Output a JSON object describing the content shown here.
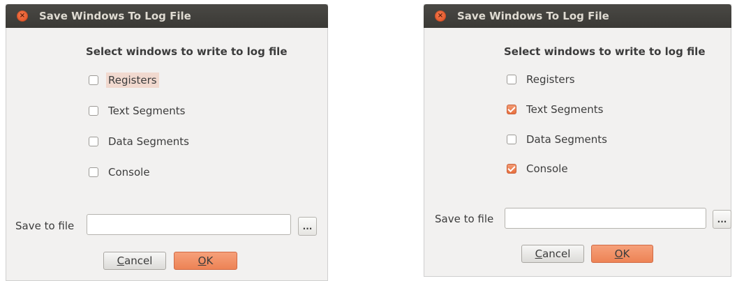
{
  "dialogs": [
    {
      "title": "Save Windows To Log File",
      "heading": "Select windows to write to log file",
      "options": [
        {
          "label": "Registers",
          "checked": false,
          "focused": true
        },
        {
          "label": "Text Segments",
          "checked": false
        },
        {
          "label": "Data Segments",
          "checked": false
        },
        {
          "label": "Console",
          "checked": false
        }
      ],
      "save_to_file_label": "Save to file",
      "file_value": "",
      "browse_label": "...",
      "cancel": {
        "mnemonic": "C",
        "rest": "ancel"
      },
      "ok": {
        "mnemonic": "O",
        "rest": "K"
      }
    },
    {
      "title": "Save Windows To Log File",
      "heading": "Select windows to write to log file",
      "options": [
        {
          "label": "Registers",
          "checked": false
        },
        {
          "label": "Text Segments",
          "checked": true
        },
        {
          "label": "Data Segments",
          "checked": false
        },
        {
          "label": "Console",
          "checked": true
        }
      ],
      "save_to_file_label": "Save to file",
      "file_value": "",
      "browse_label": "...",
      "cancel": {
        "mnemonic": "C",
        "rest": "ancel"
      },
      "ok": {
        "mnemonic": "O",
        "rest": "K"
      }
    }
  ],
  "colors": {
    "titlebar": "#3c3b37",
    "accent": "#ed8355",
    "close_button": "#e5552a"
  },
  "icons": {
    "close": "close-icon"
  }
}
